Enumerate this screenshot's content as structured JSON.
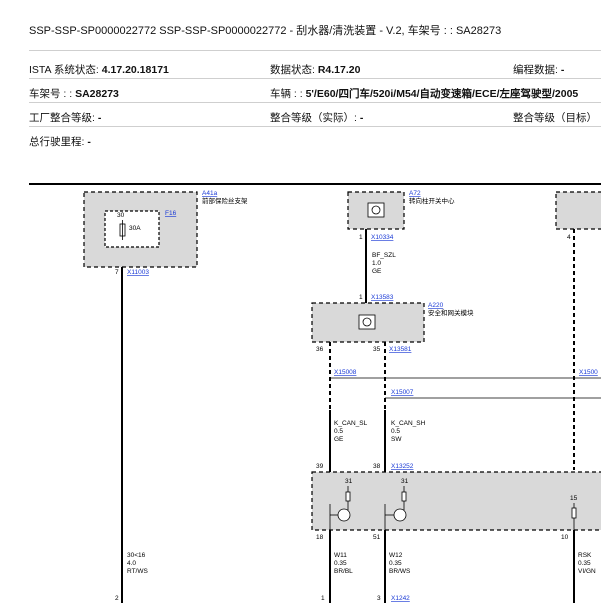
{
  "header": {
    "title": "SSP-SSP-SP0000022772 SSP-SSP-SP0000022772 - 刮水器/清洗装置 - V.2, 车架号 : : SA28273",
    "rows": [
      [
        {
          "label": "ISTA 系统状态: ",
          "value": "4.17.20.18171"
        },
        {
          "label": "数据状态: ",
          "value": "R4.17.20"
        },
        {
          "label": "编程数据: ",
          "value": "-"
        }
      ],
      [
        {
          "label": "车架号 : : ",
          "value": "SA28273"
        },
        {
          "label": "车辆 : : ",
          "value": "5'/E60/四门车/520i/M54/自动变速箱/ECE/左座驾驶型/2005"
        },
        {
          "label": "",
          "value": ""
        }
      ],
      [
        {
          "label": "工厂整合等级: ",
          "value": "-"
        },
        {
          "label": "整合等级（实际）: ",
          "value": "-"
        },
        {
          "label": "整合等级（目标）",
          "value": ""
        }
      ],
      [
        {
          "label": "总行驶里程: ",
          "value": "-"
        },
        {
          "label": "",
          "value": ""
        },
        {
          "label": "",
          "value": ""
        }
      ]
    ]
  },
  "diagram": {
    "components": {
      "a41a": {
        "id": "A41a",
        "name": "前部保险丝支架"
      },
      "f16": {
        "id": "F16",
        "pin": "30",
        "rating": "30A"
      },
      "a72": {
        "id": "A72",
        "name": "转向柱开关中心"
      },
      "a220": {
        "id": "A220",
        "name": "安全和网关模块"
      }
    },
    "connectors": {
      "x11003": "X11003",
      "x10334": "X10334",
      "x13583": "X13583",
      "x13581": "X13581",
      "x15008": "X15008",
      "x15007": "X15007",
      "x15008_edge": "X1500",
      "x13252": "X13252",
      "x1242": "X1242"
    },
    "pins": {
      "p7": "7",
      "p1a": "1",
      "p1b": "1",
      "p4": "4",
      "p36": "36",
      "p35": "35",
      "p39": "39",
      "p38": "38",
      "p18": "18",
      "p51": "51",
      "p10": "10",
      "p2": "2",
      "p1c": "1",
      "p3": "3",
      "t31a": "31",
      "t31b": "31",
      "t15": "15"
    },
    "wires": {
      "bf_szl": {
        "name": "BF_SZL",
        "size": "1.0",
        "color": "GE"
      },
      "k_can_sl": {
        "name": "K_CAN_SL",
        "size": "0.5",
        "color": "GE"
      },
      "k_can_sh": {
        "name": "K_CAN_SH",
        "size": "0.5",
        "color": "SW"
      },
      "w30": {
        "name": "30<16",
        "size": "4.0",
        "color": "RT/WS"
      },
      "w11": {
        "name": "W11",
        "size": "0.35",
        "color": "BR/BL"
      },
      "w12": {
        "name": "W12",
        "size": "0.35",
        "color": "BR/WS"
      },
      "rsk": {
        "name": "RSK",
        "size": "0.35",
        "color": "VI/GN"
      }
    }
  }
}
